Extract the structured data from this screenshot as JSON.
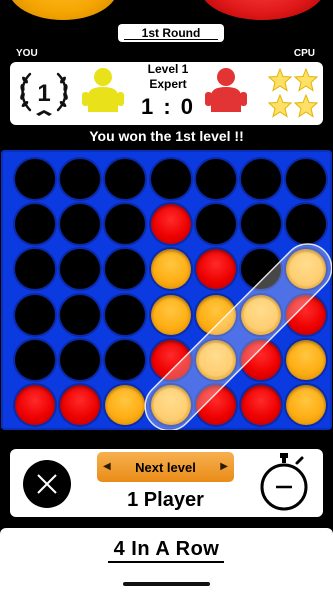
{
  "header": {
    "round_label": "1st Round",
    "player_left_label": "YOU",
    "player_right_label": "CPU"
  },
  "score": {
    "rank_badge": "1",
    "level_line1": "Level 1",
    "level_line2": "Expert",
    "score_text": "1 : 0",
    "cpu_stars": 4
  },
  "status_message": "You won the 1st level !!",
  "board": {
    "columns": 7,
    "rows": 6,
    "cells": [
      [
        "empty",
        "empty",
        "empty",
        "empty",
        "empty",
        "empty",
        "empty"
      ],
      [
        "empty",
        "empty",
        "empty",
        "red",
        "empty",
        "empty",
        "empty"
      ],
      [
        "empty",
        "empty",
        "empty",
        "yellow",
        "red",
        "empty",
        "yellow"
      ],
      [
        "empty",
        "empty",
        "empty",
        "yellow",
        "yellow",
        "yellow",
        "red"
      ],
      [
        "empty",
        "empty",
        "empty",
        "red",
        "yellow",
        "red",
        "yellow"
      ],
      [
        "red",
        "red",
        "yellow",
        "yellow",
        "red",
        "red",
        "yellow"
      ]
    ],
    "winning_line": [
      [
        5,
        3
      ],
      [
        4,
        4
      ],
      [
        3,
        5
      ],
      [
        2,
        6
      ]
    ]
  },
  "controls": {
    "next_level_label": "Next level",
    "mode_label": "1 Player"
  },
  "footer": {
    "app_title": "4 In A Row"
  },
  "colors": {
    "board_blue": "#0b3be0",
    "disc_red": "#ee0000",
    "disc_yellow": "#ffae14",
    "figure_yellow": "#e9e21a",
    "figure_red": "#e23434",
    "star_gold": "#ffe066"
  },
  "icons": {
    "laurel": "laurel-wreath-icon",
    "close": "close-x-icon",
    "timer": "stopwatch-icon",
    "star": "star-icon",
    "figure": "player-figure-icon"
  }
}
